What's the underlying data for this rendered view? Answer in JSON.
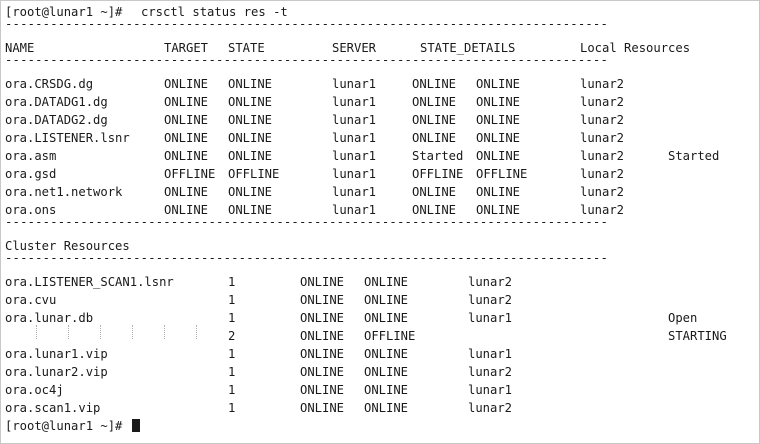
{
  "terminal": {
    "prompt": "[root@lunar1 ~]#",
    "command": "crsctl status res -t",
    "separator": "--------------------------------------------------------------------------------",
    "headers": {
      "name": "NAME",
      "target": "TARGET",
      "state": "STATE",
      "server": "SERVER",
      "state_details": "STATE_DETAILS",
      "local_resources": "Local Resources"
    },
    "local_rows": [
      {
        "name": "ora.CRSDG.dg",
        "target": "ONLINE",
        "state": "ONLINE",
        "server": "lunar1",
        "s1": "ONLINE",
        "s2": "ONLINE",
        "node": "lunar2",
        "extra": ""
      },
      {
        "name": "ora.DATADG1.dg",
        "target": "ONLINE",
        "state": "ONLINE",
        "server": "lunar1",
        "s1": "ONLINE",
        "s2": "ONLINE",
        "node": "lunar2",
        "extra": ""
      },
      {
        "name": "ora.DATADG2.dg",
        "target": "ONLINE",
        "state": "ONLINE",
        "server": "lunar1",
        "s1": "ONLINE",
        "s2": "ONLINE",
        "node": "lunar2",
        "extra": ""
      },
      {
        "name": "ora.LISTENER.lsnr",
        "target": "ONLINE",
        "state": "ONLINE",
        "server": "lunar1",
        "s1": "ONLINE",
        "s2": "ONLINE",
        "node": "lunar2",
        "extra": ""
      },
      {
        "name": "ora.asm",
        "target": "ONLINE",
        "state": "ONLINE",
        "server": "lunar1",
        "s1": "Started",
        "s2": "ONLINE",
        "node": "lunar2",
        "extra": "Started"
      },
      {
        "name": "ora.gsd",
        "target": "OFFLINE",
        "state": "OFFLINE",
        "server": "lunar1",
        "s1": "OFFLINE",
        "s2": "OFFLINE",
        "node": "lunar2",
        "extra": ""
      },
      {
        "name": "ora.net1.network",
        "target": "ONLINE",
        "state": "ONLINE",
        "server": "lunar1",
        "s1": "ONLINE",
        "s2": "ONLINE",
        "node": "lunar2",
        "extra": ""
      },
      {
        "name": "ora.ons",
        "target": "ONLINE",
        "state": "ONLINE",
        "server": "lunar1",
        "s1": "ONLINE",
        "s2": "ONLINE",
        "node": "lunar2",
        "extra": ""
      }
    ],
    "cluster_title": "Cluster Resources",
    "cluster_rows": [
      {
        "name": "ora.LISTENER_SCAN1.lsnr",
        "num": "1",
        "target": "ONLINE",
        "state": "ONLINE",
        "server": "lunar2",
        "extra": ""
      },
      {
        "name": "ora.cvu",
        "num": "1",
        "target": "ONLINE",
        "state": "ONLINE",
        "server": "lunar2",
        "extra": ""
      },
      {
        "name": "ora.lunar.db",
        "num": "1",
        "target": "ONLINE",
        "state": "ONLINE",
        "server": "lunar1",
        "extra": "Open"
      },
      {
        "name": "",
        "num": "2",
        "target": "ONLINE",
        "state": "OFFLINE",
        "server": "",
        "extra": "STARTING"
      },
      {
        "name": "ora.lunar1.vip",
        "num": "1",
        "target": "ONLINE",
        "state": "ONLINE",
        "server": "lunar1",
        "extra": ""
      },
      {
        "name": "ora.lunar2.vip",
        "num": "1",
        "target": "ONLINE",
        "state": "ONLINE",
        "server": "lunar2",
        "extra": ""
      },
      {
        "name": "ora.oc4j",
        "num": "1",
        "target": "ONLINE",
        "state": "ONLINE",
        "server": "lunar1",
        "extra": ""
      },
      {
        "name": "ora.scan1.vip",
        "num": "1",
        "target": "ONLINE",
        "state": "ONLINE",
        "server": "lunar2",
        "extra": ""
      }
    ]
  }
}
